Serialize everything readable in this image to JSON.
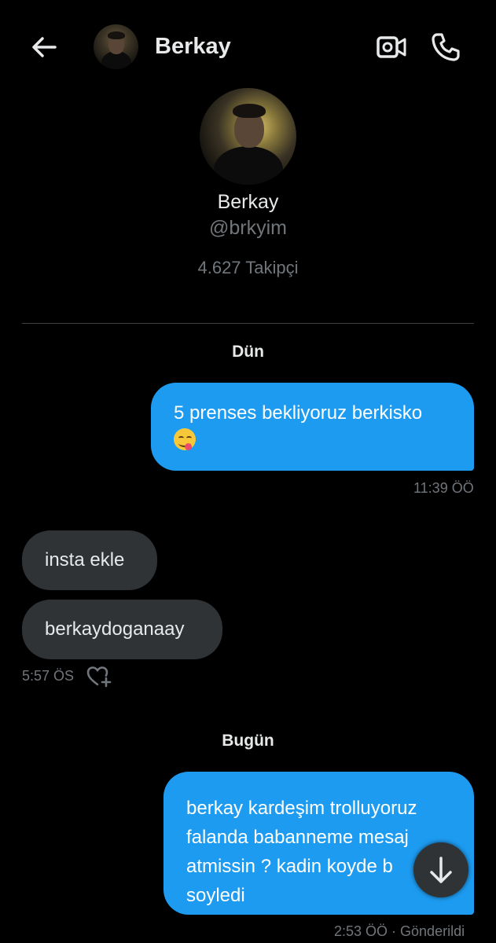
{
  "header": {
    "back_icon": "arrow-left-icon",
    "name": "Berkay",
    "video_icon": "video-camera-icon",
    "call_icon": "phone-icon"
  },
  "profile": {
    "name": "Berkay",
    "handle": "@brkyim",
    "followers": "4.627 Takipçi"
  },
  "conversation": [
    {
      "day": "Dün",
      "messages": [
        {
          "direction": "out",
          "text_line1": "5 prenses bekliyoruz berkisko",
          "emoji": "yum-face-emoji",
          "time": "11:39 ÖÖ"
        },
        {
          "direction": "in",
          "text": "insta ekle"
        },
        {
          "direction": "in",
          "text": "berkaydoganaay",
          "time": "5:57 ÖS",
          "reaction_icon": "heart-plus-icon"
        }
      ]
    },
    {
      "day": "Bugün",
      "messages": [
        {
          "direction": "out",
          "lines": [
            "berkay kardeşim trolluyoruz",
            "falanda babanneme mesaj",
            "atmissin ? kadin koyde b",
            "soyledi"
          ],
          "time": "2:53 ÖÖ · Gönderildi"
        }
      ]
    }
  ],
  "scroll_button_icon": "arrow-down-icon",
  "colors": {
    "background": "#000000",
    "accent": "#1d9bf0",
    "incoming_bubble": "#2f3336",
    "muted_text": "#71767b"
  }
}
